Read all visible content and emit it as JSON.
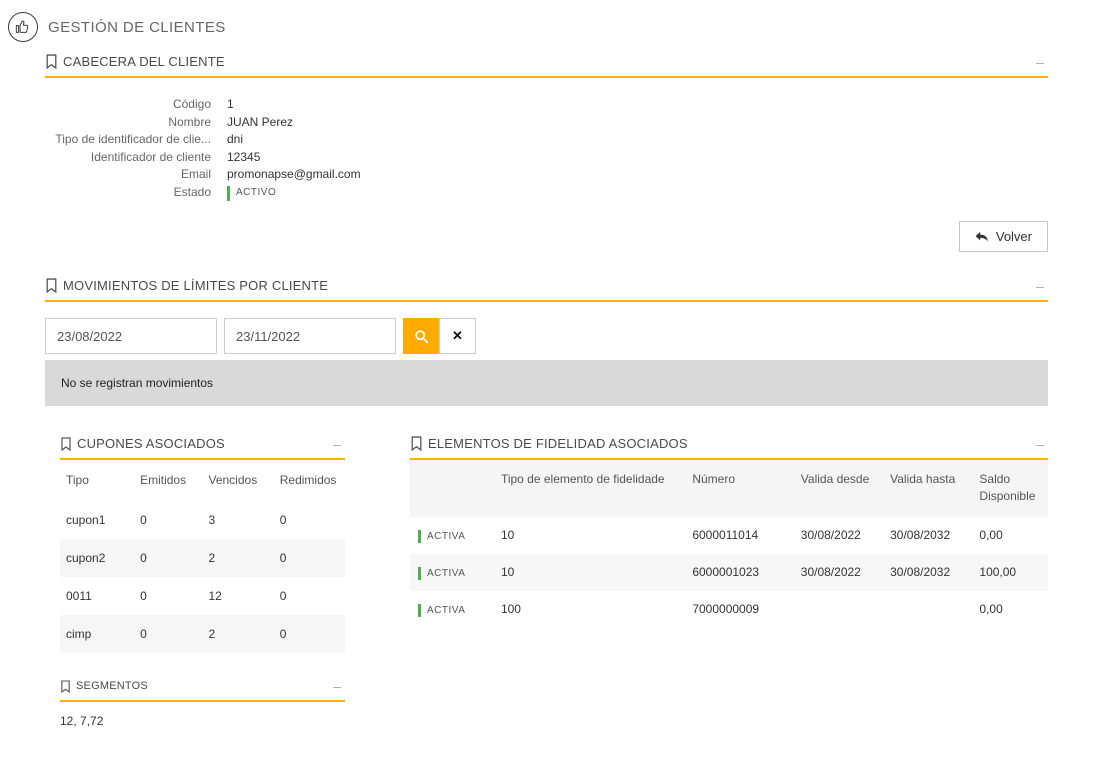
{
  "ui": {
    "collapse": "–"
  },
  "colors": {
    "accent": "#f9b200",
    "accent_button": "#ffab00",
    "green": "#4caf50"
  },
  "page": {
    "title": "GESTIÓN DE CLIENTES"
  },
  "cabecera": {
    "title": "CABECERA DEL CLIENTE",
    "fields": [
      {
        "label": "Código",
        "value": "1"
      },
      {
        "label": "Nombre",
        "value": "JUAN Perez"
      },
      {
        "label": "Tipo de identificador de clie...",
        "value": "dni"
      },
      {
        "label": "Identificador de cliente",
        "value": "12345"
      },
      {
        "label": "Email",
        "value": "promonapse@gmail.com"
      },
      {
        "label": "Estado",
        "value": "ACTIVO"
      }
    ],
    "volver_label": "Volver"
  },
  "movimientos": {
    "title": "MOVIMIENTOS DE LÍMITES POR CLIENTE",
    "date_from": "23/08/2022",
    "date_to": "23/11/2022",
    "clear_label": "✕",
    "empty_message": "No se registran movimientos"
  },
  "cupones": {
    "title": "CUPONES ASOCIADOS",
    "headers": [
      "Tipo",
      "Emitidos",
      "Vencidos",
      "Redimidos"
    ],
    "rows": [
      [
        "cupon1",
        "0",
        "3",
        "0"
      ],
      [
        "cupon2",
        "0",
        "2",
        "0"
      ],
      [
        "0011",
        "0",
        "12",
        "0"
      ],
      [
        "cimp",
        "0",
        "2",
        "0"
      ]
    ]
  },
  "segmentos": {
    "title": "SEGMENTOS",
    "value": "12, 7,72"
  },
  "fidelidad": {
    "title": "ELEMENTOS DE FIDELIDAD ASOCIADOS",
    "headers": [
      "",
      "Tipo de elemento de fidelidade",
      "Número",
      "Valida desde",
      "Valida hasta",
      "Saldo Disponible"
    ],
    "rows": [
      {
        "estado": "ACTIVA",
        "tipo": "10",
        "numero": "6000011014",
        "desde": "30/08/2022",
        "hasta": "30/08/2032",
        "saldo": "0,00"
      },
      {
        "estado": "ACTIVA",
        "tipo": "10",
        "numero": "6000001023",
        "desde": "30/08/2022",
        "hasta": "30/08/2032",
        "saldo": "100,00"
      },
      {
        "estado": "ACTIVA",
        "tipo": "100",
        "numero": "7000000009",
        "desde": "",
        "hasta": "",
        "saldo": "0,00"
      }
    ]
  }
}
